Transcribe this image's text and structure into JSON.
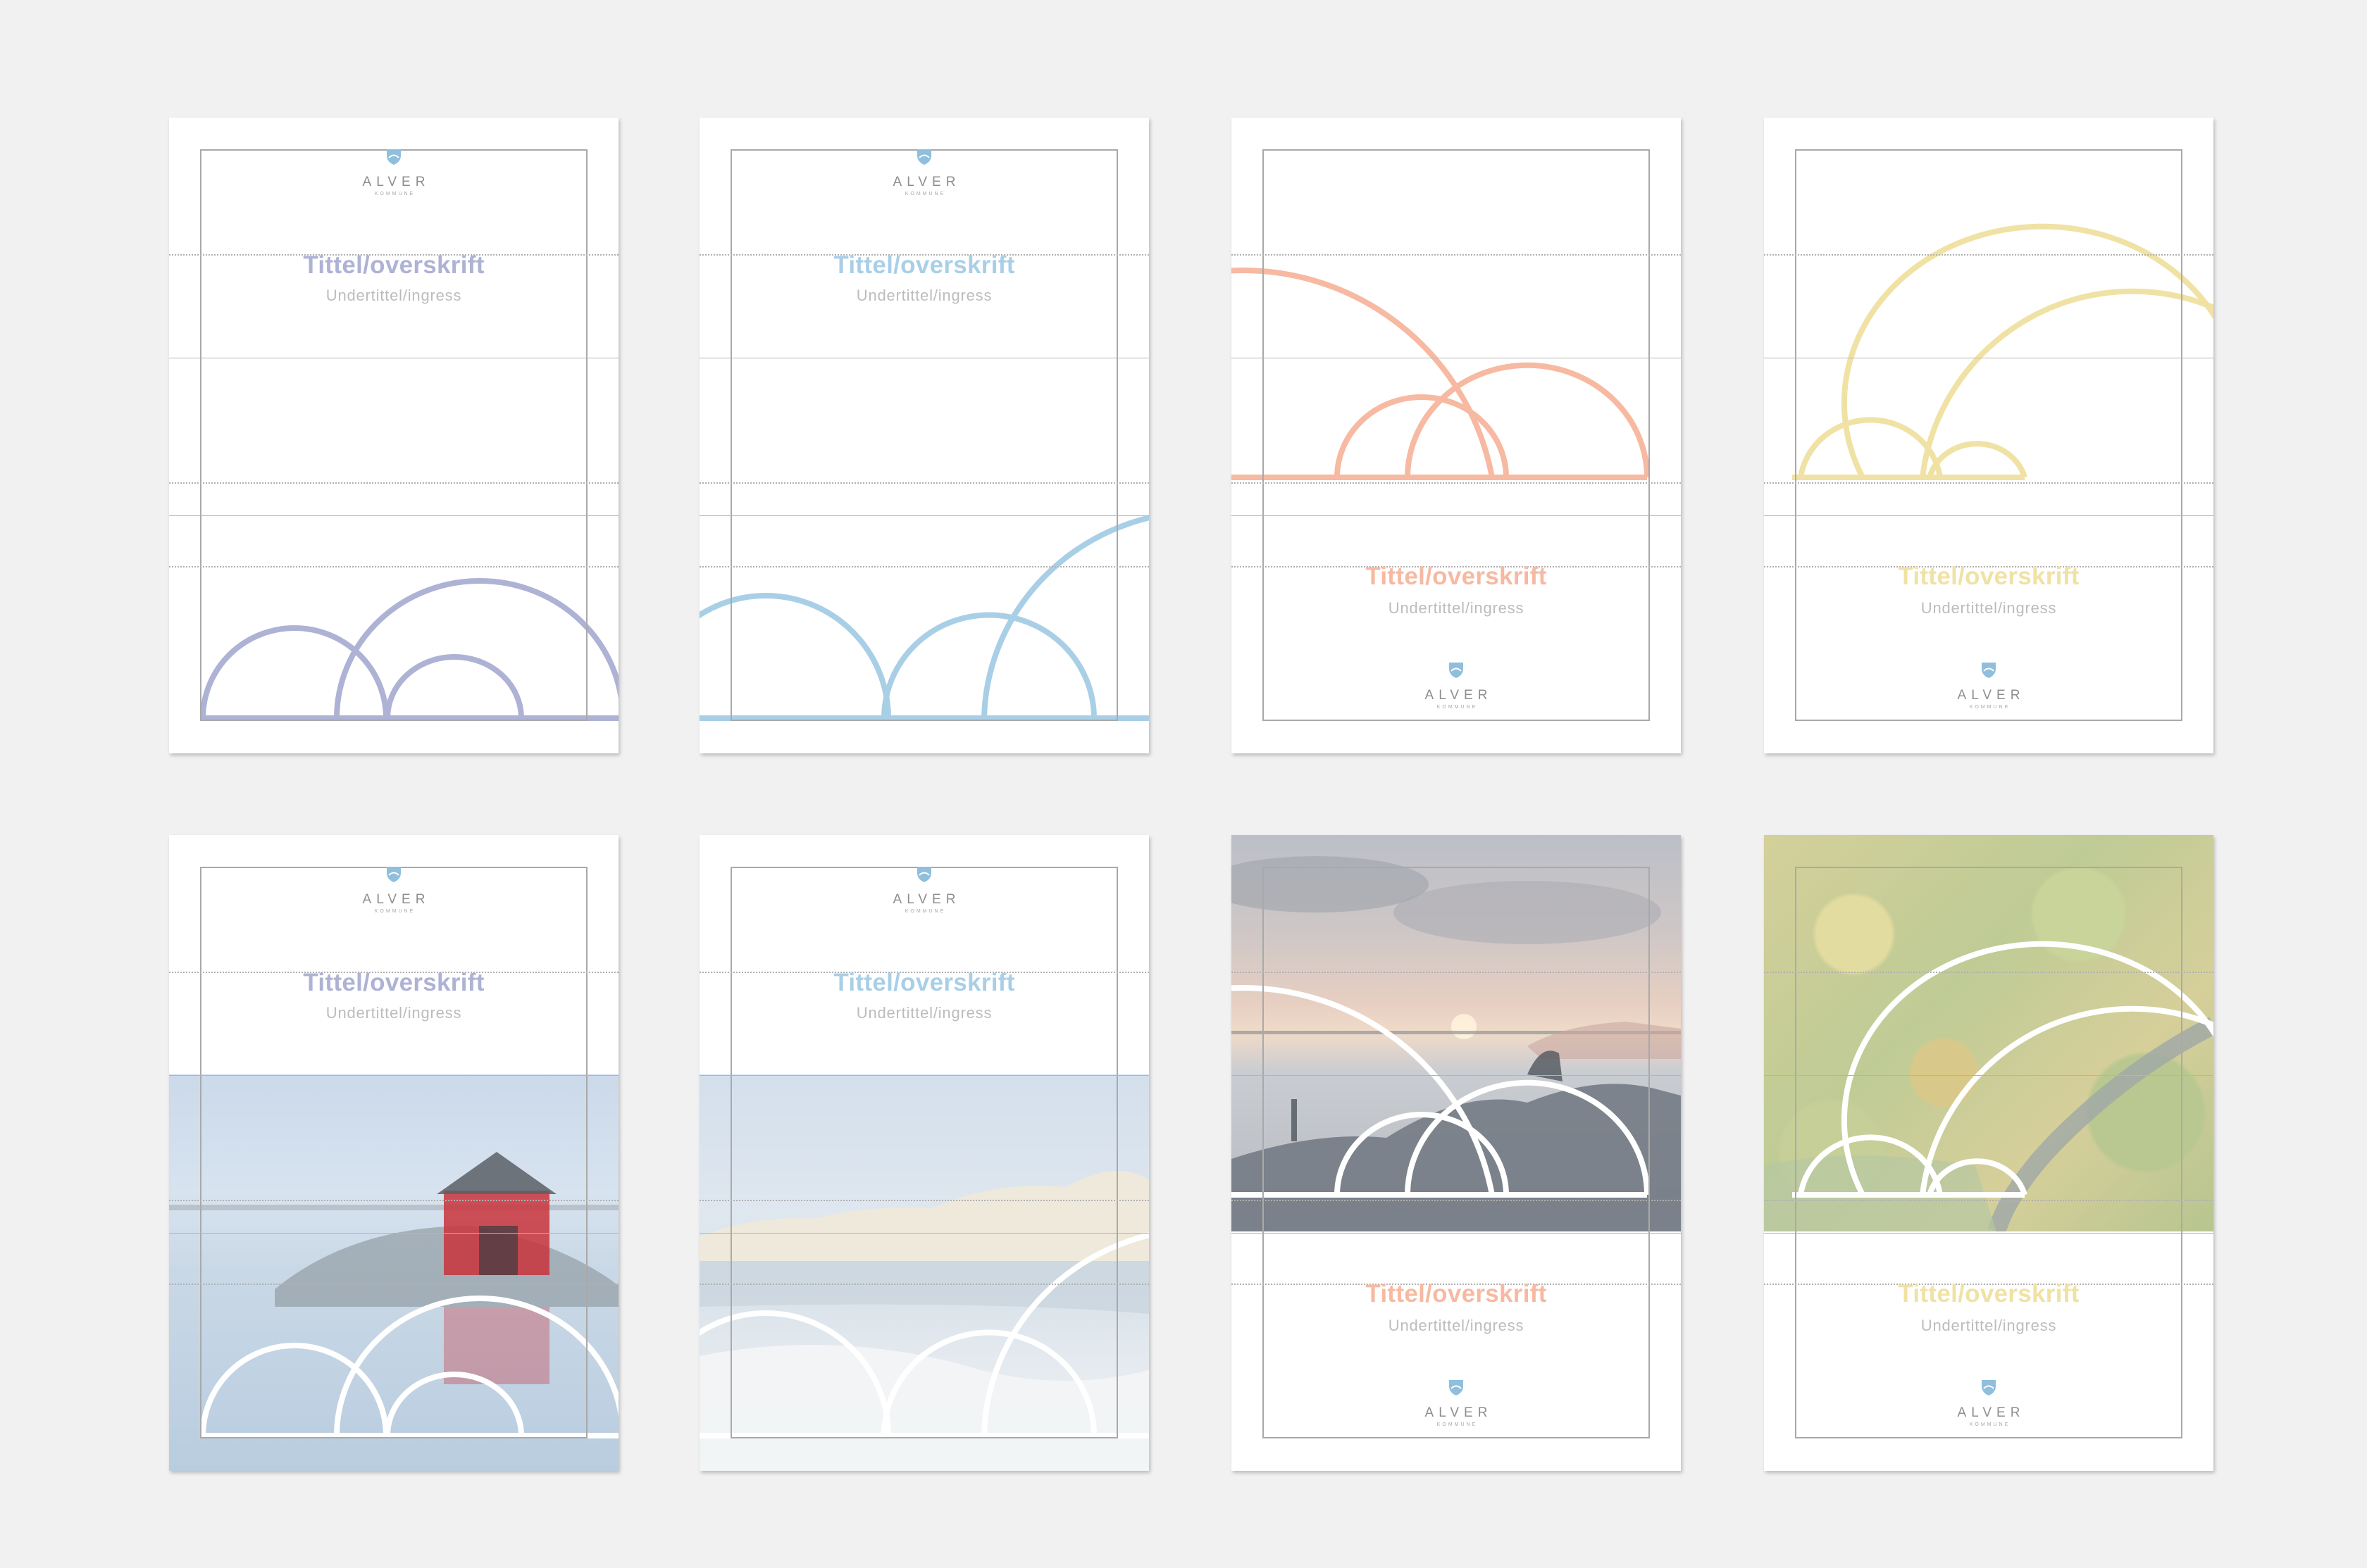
{
  "sheets": [
    {
      "title": "Tittel/overskrift",
      "subtitle": "Undertittel/ingress",
      "logo_name": "ALVER",
      "logo_sub": "KOMMUNE",
      "accent": "#aeb2d4",
      "image": "none"
    },
    {
      "title": "Tittel/overskrift",
      "subtitle": "Undertittel/ingress",
      "logo_name": "ALVER",
      "logo_sub": "KOMMUNE",
      "accent": "#a9cfe7",
      "image": "none"
    },
    {
      "title": "Tittel/overskrift",
      "subtitle": "Undertittel/ingress",
      "logo_name": "ALVER",
      "logo_sub": "KOMMUNE",
      "accent": "#f7b9a1",
      "image": "none"
    },
    {
      "title": "Tittel/overskrift",
      "subtitle": "Undertittel/ingress",
      "logo_name": "ALVER",
      "logo_sub": "KOMMUNE",
      "accent": "#f0e2a4",
      "image": "none"
    },
    {
      "title": "Tittel/overskrift",
      "subtitle": "Undertittel/ingress",
      "logo_name": "ALVER",
      "logo_sub": "KOMMUNE",
      "accent": "#aeb2d4",
      "image": "boathouse-photo"
    },
    {
      "title": "Tittel/overskrift",
      "subtitle": "Undertittel/ingress",
      "logo_name": "ALVER",
      "logo_sub": "KOMMUNE",
      "accent": "#a9cfe7",
      "image": "winter-lake-photo"
    },
    {
      "title": "Tittel/overskrift",
      "subtitle": "Undertittel/ingress",
      "logo_name": "ALVER",
      "logo_sub": "KOMMUNE",
      "accent": "#f7b9a1",
      "image": "sunset-coast-photo"
    },
    {
      "title": "Tittel/overskrift",
      "subtitle": "Undertittel/ingress",
      "logo_name": "ALVER",
      "logo_sub": "KOMMUNE",
      "accent": "#f0e2a4",
      "image": "forest-aerial-photo"
    }
  ],
  "colors": {
    "logo_blue": "#8fbfdc",
    "frame": "#a9a9a9",
    "subtitle": "#bcbcbc"
  }
}
